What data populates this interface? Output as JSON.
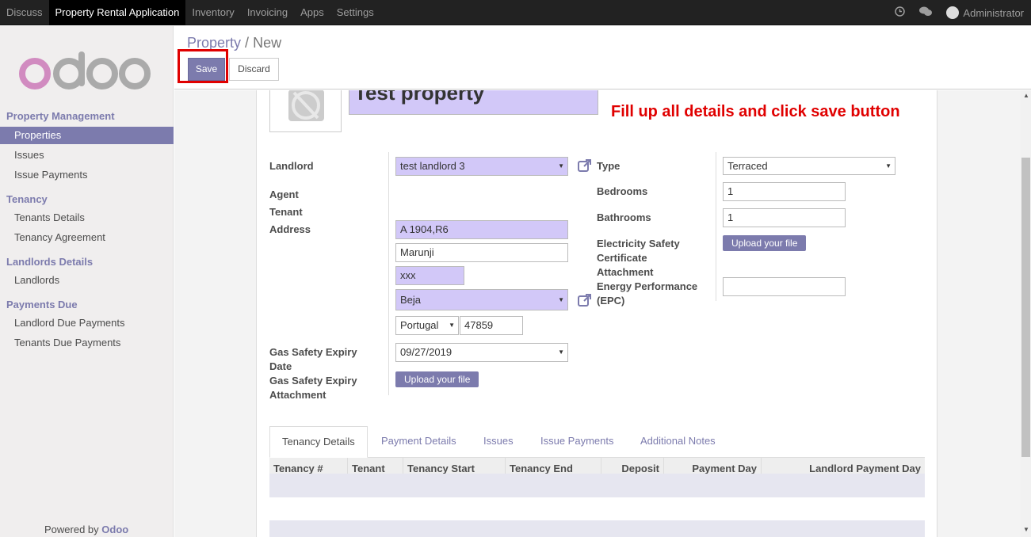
{
  "topbar": {
    "menu": [
      "Discuss",
      "Property Rental Application",
      "Inventory",
      "Invoicing",
      "Apps",
      "Settings"
    ],
    "user": "Administrator"
  },
  "sidebar": {
    "sections": [
      {
        "title": "Property Management",
        "items": [
          "Properties",
          "Issues",
          "Issue Payments"
        ]
      },
      {
        "title": "Tenancy",
        "items": [
          "Tenants Details",
          "Tenancy Agreement"
        ]
      },
      {
        "title": "Landlords Details",
        "items": [
          "Landlords"
        ]
      },
      {
        "title": "Payments Due",
        "items": [
          "Landlord Due Payments",
          "Tenants Due Payments"
        ]
      }
    ],
    "powered_prefix": "Powered by",
    "powered_brand": "Odoo"
  },
  "control_panel": {
    "breadcrumb_parent": "Property",
    "breadcrumb_sep": "/",
    "breadcrumb_current": "New",
    "save_label": "Save",
    "discard_label": "Discard"
  },
  "form": {
    "name": "Test property",
    "annotation": "Fill up all details and click save button",
    "labels": {
      "landlord": "Landlord",
      "agent": "Agent",
      "tenant": "Tenant",
      "address": "Address",
      "gas_expiry_1": "Gas Safety Expiry",
      "gas_expiry_2": "Date",
      "gas_attach_1": "Gas Safety Expiry",
      "gas_attach_2": "Attachment",
      "type": "Type",
      "bedrooms": "Bedrooms",
      "bathrooms": "Bathrooms",
      "elec_1": "Electricity Safety",
      "elec_2": "Certificate",
      "elec_3": "Attachment",
      "epc_1": "Energy Performance",
      "epc_2": "(EPC)"
    },
    "values": {
      "landlord": "test landlord 3",
      "street": "A 1904,R6",
      "street2": "Marunji",
      "city": "xxx",
      "state": "Beja",
      "country": "Portugal",
      "zip": "47859",
      "gas_expiry": "09/27/2019",
      "type": "Terraced",
      "bedrooms": "1",
      "bathrooms": "1",
      "epc": ""
    },
    "upload_label": "Upload your file"
  },
  "tabs": [
    "Tenancy Details",
    "Payment Details",
    "Issues",
    "Issue Payments",
    "Additional Notes"
  ],
  "table": {
    "columns": [
      "Tenancy #",
      "Tenant",
      "Tenancy Start",
      "Tenancy End",
      "Deposit",
      "Payment Day",
      "Landlord Payment Day"
    ]
  },
  "colors": {
    "accent": "#7c7bad",
    "required_field": "#d2c8f8",
    "annotation": "#e00000"
  },
  "icons": [
    "clock-icon",
    "chat-icon",
    "external-link-icon",
    "dropdown-caret-icon",
    "camera-placeholder-icon"
  ]
}
